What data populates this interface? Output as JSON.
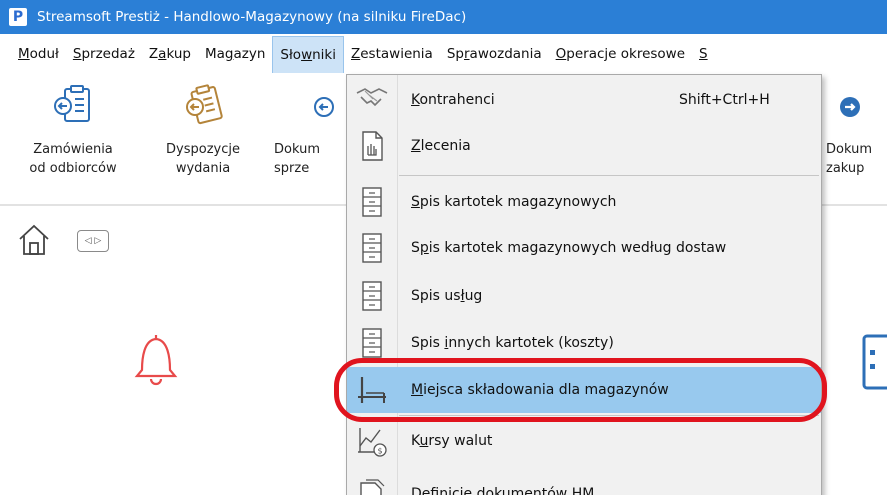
{
  "window": {
    "app_logo": "P",
    "title": "Streamsoft Prestiż - Handlowo-Magazynowy (na silniku FireDac)"
  },
  "menubar": {
    "items": [
      {
        "pre": "",
        "ul": "M",
        "post": "oduł"
      },
      {
        "pre": "",
        "ul": "S",
        "post": "przedaż"
      },
      {
        "pre": "Z",
        "ul": "a",
        "post": "kup"
      },
      {
        "pre": "Ma",
        "ul": "g",
        "post": "azyn"
      },
      {
        "pre": "Sło",
        "ul": "w",
        "post": "niki"
      },
      {
        "pre": "",
        "ul": "Z",
        "post": "estawienia"
      },
      {
        "pre": "Sp",
        "ul": "r",
        "post": "awozdania"
      },
      {
        "pre": "",
        "ul": "O",
        "post": "peracje okresowe"
      },
      {
        "pre": "",
        "ul": "S",
        "post": ""
      }
    ]
  },
  "ribbon": {
    "buttons": [
      {
        "line1": "Zamówienia",
        "line2": "od odbiorców",
        "icon": "order-clipboard-icon"
      },
      {
        "line1": "Dyspozycje",
        "line2": "wydania",
        "icon": "dispatch-clipboard-icon"
      },
      {
        "line1": "Dokum",
        "line2": "sprze",
        "icon": "sales-document-icon"
      },
      {
        "line1": "Dokum",
        "line2": "zakup",
        "icon": "purchase-document-icon"
      }
    ]
  },
  "nav": {
    "home_icon": "home-icon",
    "tabs_button": "◁ ▷"
  },
  "dropdown": {
    "items": [
      {
        "pre": "",
        "ul": "K",
        "post": "ontrahenci",
        "shortcut": "Shift+Ctrl+H",
        "icon": "handshake-icon"
      },
      {
        "pre": "",
        "ul": "Z",
        "post": "lecenia",
        "shortcut": "",
        "icon": "document-hand-icon"
      },
      {
        "pre": "",
        "ul": "S",
        "post": "pis kartotek magazynowych",
        "shortcut": "",
        "icon": "file-cabinet-icon"
      },
      {
        "pre": "S",
        "ul": "p",
        "post": "is kartotek magazynowych według dostaw",
        "shortcut": "",
        "icon": "file-cabinet-icon"
      },
      {
        "pre": "Spis us",
        "ul": "ł",
        "post": "ug",
        "shortcut": "",
        "icon": "file-cabinet-icon"
      },
      {
        "pre": "Spis ",
        "ul": "i",
        "post": "nnych kartotek (koszty)",
        "shortcut": "",
        "icon": "file-cabinet-icon"
      },
      {
        "pre": "",
        "ul": "M",
        "post": "iejsca składowania dla magazynów",
        "shortcut": "",
        "icon": "shelf-icon"
      },
      {
        "pre": "K",
        "ul": "u",
        "post": "rsy walut",
        "shortcut": "",
        "icon": "currency-chart-icon"
      },
      {
        "pre": "Definicje dokumentów HM",
        "ul": "",
        "post": "",
        "shortcut": "",
        "icon": "document-definitions-icon"
      }
    ],
    "highlighted_index": 6
  },
  "colors": {
    "titlebar": "#2b7fd6",
    "highlight": "#98c9ee",
    "annotation": "#e0141e",
    "bell": "#e84a4a"
  }
}
